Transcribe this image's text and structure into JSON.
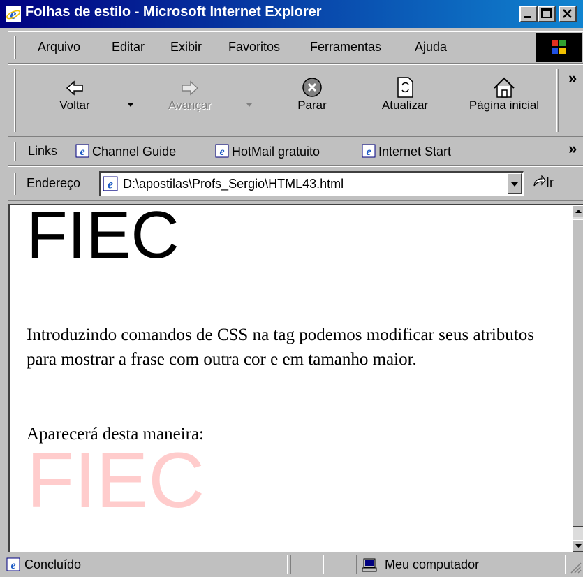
{
  "window": {
    "title": "Folhas de estilo - Microsoft Internet Explorer"
  },
  "menu": [
    "Arquivo",
    "Editar",
    "Exibir",
    "Favoritos",
    "Ferramentas",
    "Ajuda"
  ],
  "toolbar": {
    "back": "Voltar",
    "forward": "Avançar",
    "stop": "Parar",
    "refresh": "Atualizar",
    "home": "Página inicial",
    "chevron": "»"
  },
  "links": {
    "label": "Links",
    "items": [
      "Channel Guide",
      "HotMail gratuito",
      "Internet Start"
    ],
    "chevron": "»"
  },
  "address": {
    "label": "Endereço",
    "value": "D:\\apostilas\\Profs_Sergio\\HTML43.html",
    "go": "Ir"
  },
  "content": {
    "heading1": "FIEC",
    "paragraph1": "Introduzindo comandos de CSS na tag podemos modificar seus atributos para mostrar a frase com outra cor e em tamanho maior.",
    "paragraph2": "Aparecerá desta maneira:",
    "heading2": "FIEC",
    "heading2_color": "#ffcccc"
  },
  "status": {
    "text": "Concluído",
    "zone": "Meu computador"
  },
  "colors": {
    "titlebar_start": "#000080",
    "titlebar_end": "#1084d0",
    "face": "#c0c0c0"
  }
}
